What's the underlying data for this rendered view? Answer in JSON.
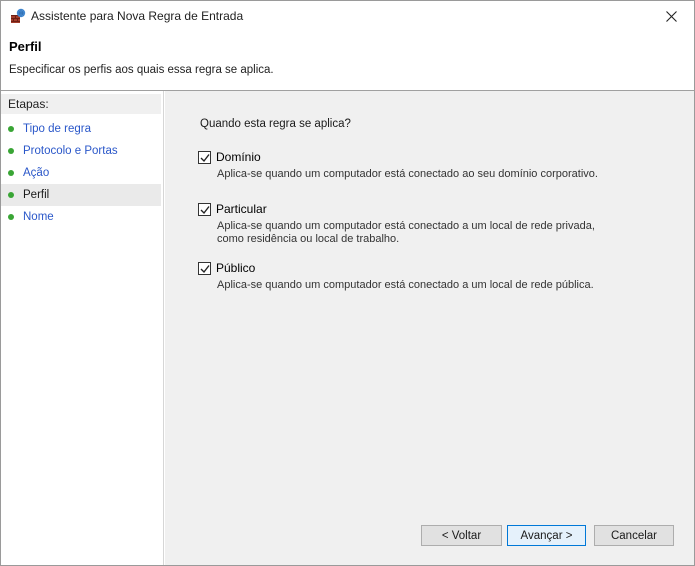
{
  "window": {
    "title": "Assistente para Nova Regra de Entrada",
    "close_icon": "close-icon"
  },
  "header": {
    "title": "Perfil",
    "description": "Especificar os perfis aos quais essa regra se aplica."
  },
  "steps": {
    "title": "Etapas:",
    "items": [
      {
        "label": "Tipo de regra",
        "active": false
      },
      {
        "label": "Protocolo e Portas",
        "active": false
      },
      {
        "label": "Ação",
        "active": false
      },
      {
        "label": "Perfil",
        "active": true
      },
      {
        "label": "Nome",
        "active": false
      }
    ]
  },
  "content": {
    "question": "Quando esta regra se aplica?",
    "options": [
      {
        "label": "Domínio",
        "checked": true,
        "description": "Aplica-se quando um computador está conectado ao seu domínio corporativo."
      },
      {
        "label": "Particular",
        "checked": true,
        "description": "Aplica-se quando um computador está conectado a um local de rede privada, como residência ou local de trabalho."
      },
      {
        "label": "Público",
        "checked": true,
        "description": "Aplica-se quando um computador está conectado a um local de rede pública."
      }
    ]
  },
  "buttons": {
    "back": "< Voltar",
    "next": "Avançar >",
    "cancel": "Cancelar"
  },
  "colors": {
    "step_dot": "#39a535",
    "step_link": "#2a57c9",
    "content_bg": "#f0f0f0",
    "primary_border": "#0078d7"
  }
}
